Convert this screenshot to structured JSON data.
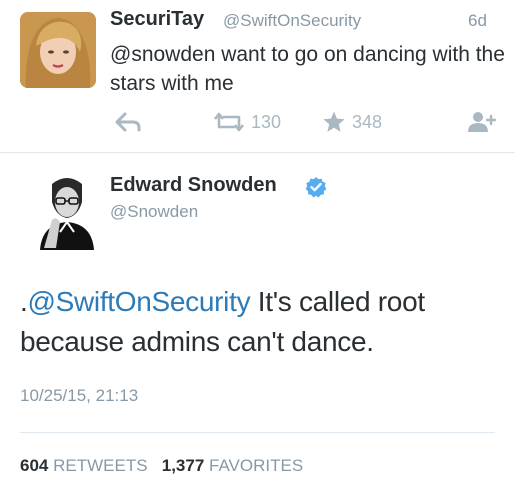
{
  "tweet1": {
    "name": "SecuriTay",
    "handle": "@SwiftOnSecurity",
    "time": "6d",
    "text": "@snowden want to go on dancing with the stars with me",
    "retweets": "130",
    "favorites": "348",
    "icons": {
      "reply": "reply-icon",
      "retweet": "retweet-icon",
      "favorite": "star-icon",
      "follow": "follow-user-icon"
    }
  },
  "tweet2": {
    "name": "Edward Snowden",
    "verified": true,
    "handle": "@Snowden",
    "text_prefix": ".",
    "text_mention": "@SwiftOnSecurity",
    "text_body": " It's called root because admins can't dance.",
    "date": "10/25/15, 21:13",
    "retweets_count": "604",
    "retweets_label": "RETWEETS",
    "favorites_count": "1,377",
    "favorites_label": "FAVORITES"
  },
  "colors": {
    "text": "#292f33",
    "muted": "#8899a6",
    "link": "#2b7bb9",
    "icon": "#aab8c2",
    "verified": "#55acee",
    "divider": "#e1e8ed"
  }
}
